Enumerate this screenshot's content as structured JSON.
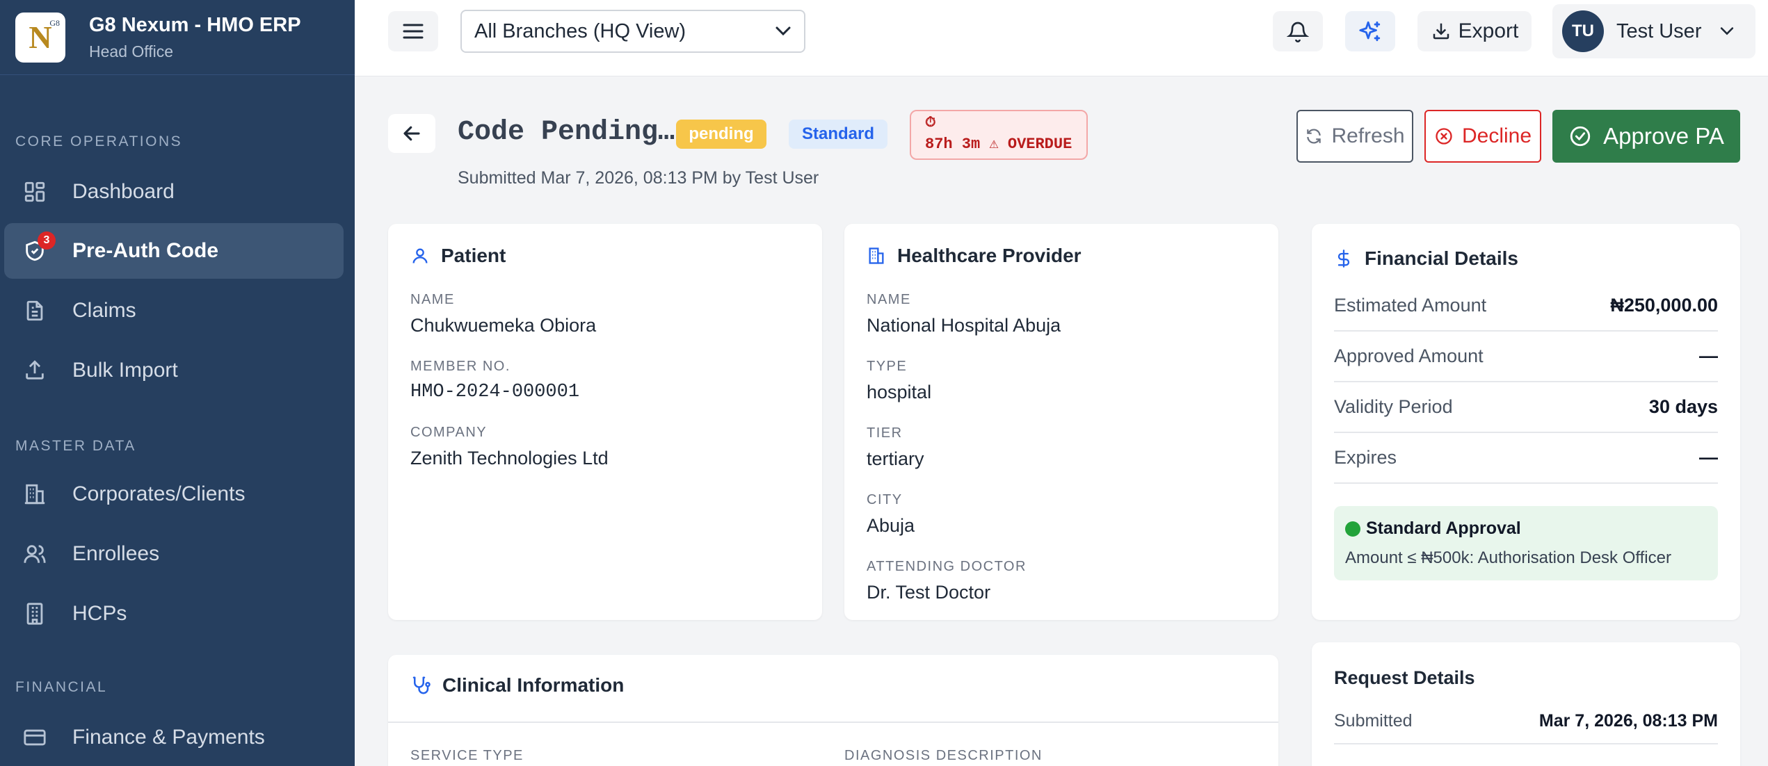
{
  "brand": {
    "title": "G8 Nexum - HMO ERP",
    "subtitle": "Head Office",
    "logo_letter": "N",
    "logo_mark": "G8"
  },
  "sidebar": {
    "sections": {
      "core": "CORE OPERATIONS",
      "master": "MASTER DATA",
      "financial": "FINANCIAL"
    },
    "items": [
      {
        "label": "Dashboard",
        "icon": "dashboard-icon"
      },
      {
        "label": "Pre-Auth Code",
        "icon": "shield-check-icon",
        "badge": "3",
        "active": true
      },
      {
        "label": "Claims",
        "icon": "document-icon"
      },
      {
        "label": "Bulk Import",
        "icon": "upload-icon"
      },
      {
        "label": "Corporates/Clients",
        "icon": "building-icon"
      },
      {
        "label": "Enrollees",
        "icon": "users-icon"
      },
      {
        "label": "HCPs",
        "icon": "hospital-icon"
      },
      {
        "label": "Finance & Payments",
        "icon": "credit-card-icon"
      }
    ]
  },
  "topbar": {
    "branch_selected": "All Branches (HQ View)",
    "export_label": "Export",
    "user_initials": "TU",
    "user_name": "Test User"
  },
  "header": {
    "title": "Code Pending…",
    "status_badge": "pending",
    "type_badge": "Standard",
    "overdue_line1": "⏱",
    "overdue_line2": "87h 3m ⚠ OVERDUE",
    "submitted": "Submitted Mar 7, 2026, 08:13 PM by Test User",
    "refresh_label": "Refresh",
    "decline_label": "Decline",
    "approve_label": "Approve PA"
  },
  "patient": {
    "title": "Patient",
    "name_label": "NAME",
    "name": "Chukwuemeka Obiora",
    "member_label": "MEMBER NO.",
    "member_no": "HMO-2024-000001",
    "company_label": "COMPANY",
    "company": "Zenith Technologies Ltd"
  },
  "provider": {
    "title": "Healthcare Provider",
    "name_label": "NAME",
    "name": "National Hospital Abuja",
    "type_label": "TYPE",
    "type": "hospital",
    "tier_label": "TIER",
    "tier": "tertiary",
    "city_label": "CITY",
    "city": "Abuja",
    "doctor_label": "ATTENDING DOCTOR",
    "doctor": "Dr. Test Doctor"
  },
  "financial": {
    "title": "Financial Details",
    "rows": [
      {
        "label": "Estimated Amount",
        "value": "₦250,000.00"
      },
      {
        "label": "Approved Amount",
        "value": "—"
      },
      {
        "label": "Validity Period",
        "value": "30 days"
      },
      {
        "label": "Expires",
        "value": "—"
      }
    ],
    "approval_title": "Standard Approval",
    "approval_desc": "Amount ≤ ₦500k: Authorisation Desk Officer"
  },
  "clinical": {
    "title": "Clinical Information",
    "service_type_label": "SERVICE TYPE",
    "diagnosis_label": "DIAGNOSIS DESCRIPTION"
  },
  "request": {
    "title": "Request Details",
    "submitted_label": "Submitted",
    "submitted_value": "Mar 7, 2026, 08:13 PM"
  },
  "colors": {
    "sidebar": "#263f5f",
    "accent_blue": "#2563eb",
    "pending": "#f7c64a",
    "approve": "#2f7d4a",
    "decline": "#dc2626"
  }
}
